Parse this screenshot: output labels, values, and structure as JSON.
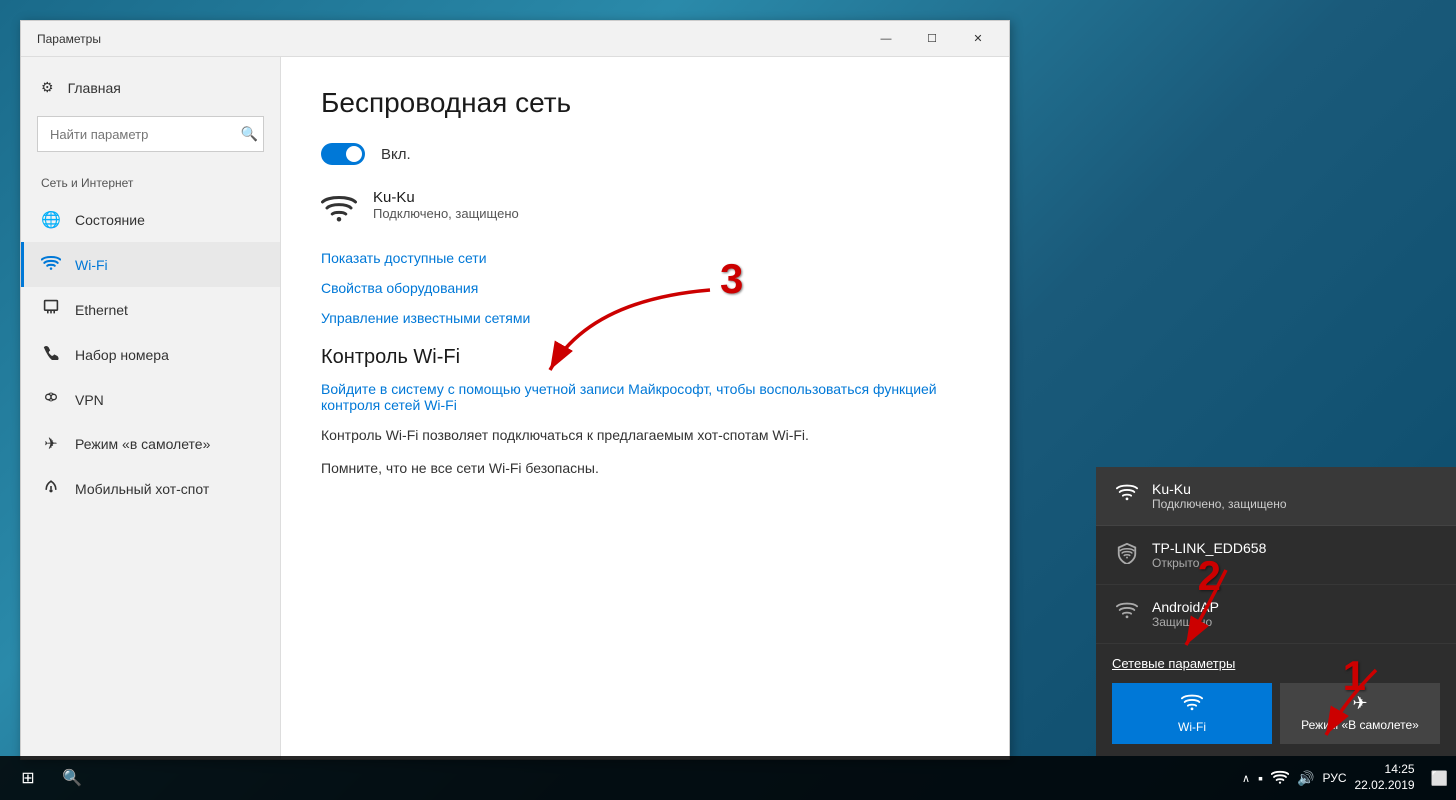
{
  "window": {
    "title": "Параметры",
    "controls": {
      "minimize": "—",
      "maximize": "☐",
      "close": "✕"
    }
  },
  "sidebar": {
    "home_label": "Главная",
    "search_placeholder": "Найти параметр",
    "section_title": "Сеть и Интернет",
    "items": [
      {
        "id": "status",
        "label": "Состояние",
        "icon": "🌐"
      },
      {
        "id": "wifi",
        "label": "Wi-Fi",
        "icon": "📶",
        "active": true
      },
      {
        "id": "ethernet",
        "label": "Ethernet",
        "icon": "🖥"
      },
      {
        "id": "dialup",
        "label": "Набор номера",
        "icon": "📞"
      },
      {
        "id": "vpn",
        "label": "VPN",
        "icon": "🔗"
      },
      {
        "id": "airplane",
        "label": "Режим «в самолете»",
        "icon": "✈"
      },
      {
        "id": "hotspot",
        "label": "Мобильный хот-спот",
        "icon": "📡"
      }
    ]
  },
  "main": {
    "title": "Беспроводная сеть",
    "toggle_label": "Вкл.",
    "connected_network": {
      "name": "Ku-Ku",
      "status": "Подключено, защищено"
    },
    "links": [
      "Показать доступные сети",
      "Свойства оборудования",
      "Управление известными сетями"
    ],
    "wifi_control_title": "Контроль Wi-Fi",
    "wifi_control_link": "Войдите в систему с помощью учетной записи Майкрософт, чтобы воспользоваться функцией контроля сетей Wi-Fi",
    "wifi_control_desc1": "Контроль Wi-Fi позволяет подключаться к предлагаемым хот-спотам Wi-Fi.",
    "wifi_control_desc2": "Помните, что не все сети Wi-Fi безопасны."
  },
  "flyout": {
    "networks": [
      {
        "name": "Ku-Ku",
        "status": "Подключено, защищено",
        "connected": true,
        "icon": "wifi"
      },
      {
        "name": "TP-LINK_EDD658",
        "status": "Открыто",
        "connected": false,
        "icon": "shield"
      },
      {
        "name": "AndroidAP",
        "status": "Защищено",
        "connected": false,
        "icon": "wifi"
      }
    ],
    "settings_link": "Сетевые параметры",
    "quick_buttons": [
      {
        "label": "Wi-Fi",
        "icon": "📶",
        "active": true
      },
      {
        "label": "Режим «В самолете»",
        "icon": "✈",
        "active": false
      }
    ]
  },
  "taskbar": {
    "time": "14:25",
    "date": "22.02.2019",
    "language": "РУС"
  },
  "annotations": {
    "num1": "1",
    "num2": "2",
    "num3": "3"
  }
}
